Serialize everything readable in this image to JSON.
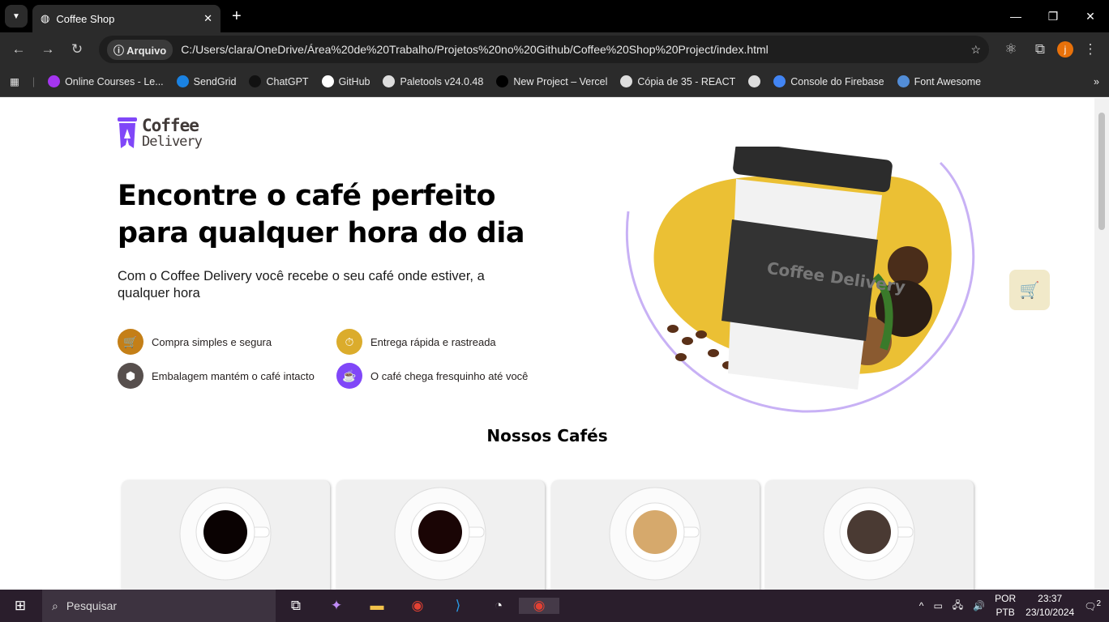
{
  "browser": {
    "tab_title": "Coffee Shop",
    "address_chip": "Arquivo",
    "url": "C:/Users/clara/OneDrive/Área%20de%20Trabalho/Projetos%20no%20Github/Coffee%20Shop%20Project/index.html",
    "profile_initial": "j",
    "bookmarks": [
      {
        "label": "Online Courses - Le...",
        "color": "#a435f0"
      },
      {
        "label": "SendGrid",
        "color": "#1a82e2"
      },
      {
        "label": "ChatGPT",
        "color": "#111"
      },
      {
        "label": "GitHub",
        "color": "#fff"
      },
      {
        "label": "Paletools v24.0.48",
        "color": "#ddd"
      },
      {
        "label": "New Project – Vercel",
        "color": "#000"
      },
      {
        "label": "Cópia de 35 - REACT",
        "color": "#ddd"
      },
      {
        "label": "",
        "color": "#ddd"
      },
      {
        "label": "Console do Firebase",
        "color": "#4285f4"
      },
      {
        "label": "Font Awesome",
        "color": "#528dd7"
      }
    ]
  },
  "page": {
    "logo": {
      "line1": "Coffee",
      "line2": "Delivery"
    },
    "title": "Encontre o café perfeito para qualquer hora do dia",
    "subtitle": "Com o Coffee Delivery você recebe o seu café onde estiver, a qualquer hora",
    "features": [
      {
        "label": "Compra simples e segura",
        "icon": "cart-icon",
        "color": "#c47f17"
      },
      {
        "label": "Entrega rápida e rastreada",
        "icon": "timer-icon",
        "color": "#dbac2c"
      },
      {
        "label": "Embalagem mantém o café intacto",
        "icon": "package-icon",
        "color": "#574f4d"
      },
      {
        "label": "O café chega fresquinho até você",
        "icon": "coffee-icon",
        "color": "#8047f8"
      }
    ],
    "section_title": "Nossos Cafés",
    "cup_logo": "Coffee Delivery"
  },
  "taskbar": {
    "search": "Pesquisar",
    "lang1": "POR",
    "lang2": "PTB",
    "time": "23:37",
    "date": "23/10/2024",
    "notifications": "2"
  }
}
